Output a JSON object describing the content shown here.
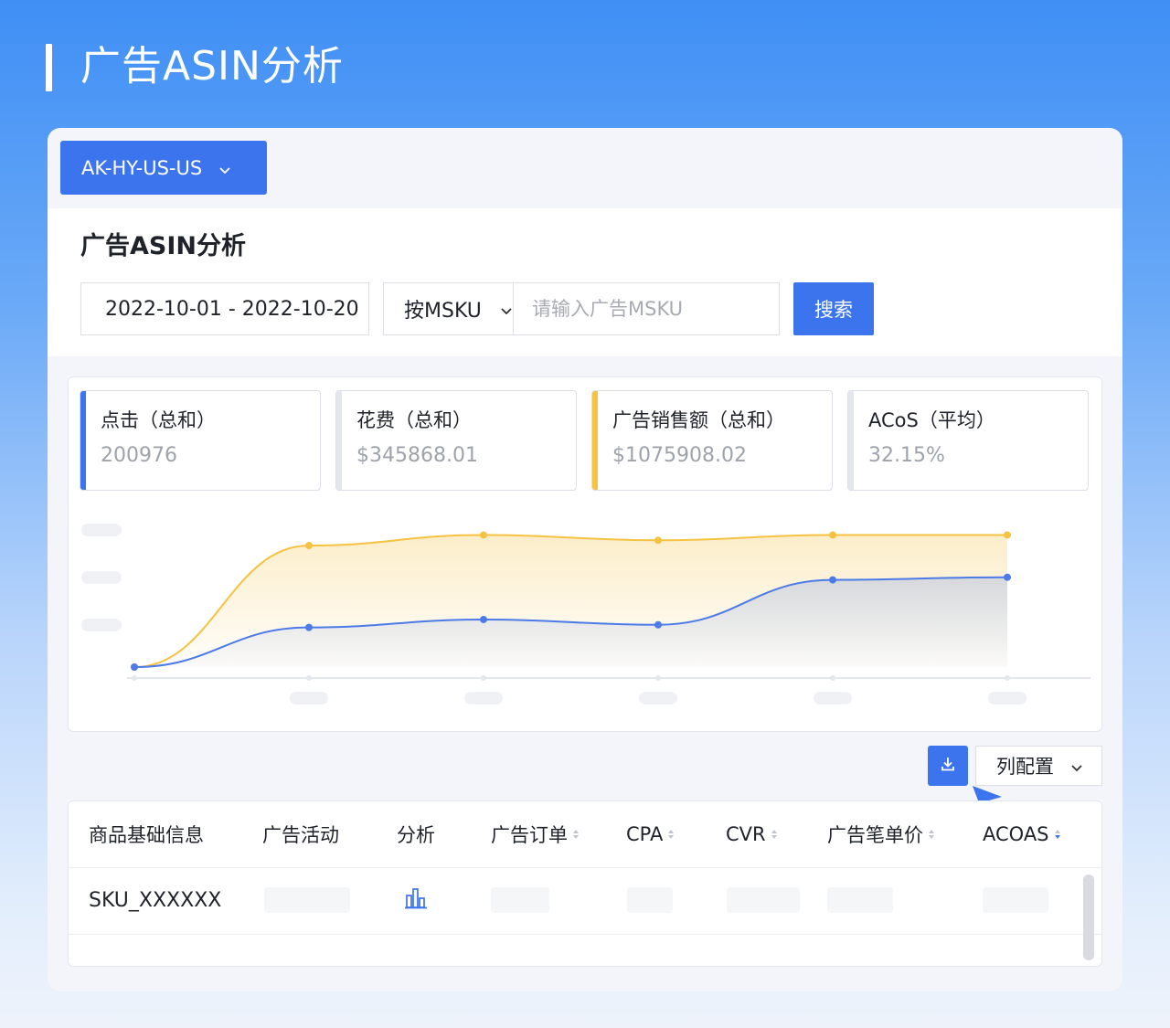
{
  "page": {
    "title": "广告ASIN分析"
  },
  "shop_selector": {
    "label": "AK-HY-US-US"
  },
  "filters": {
    "section_title": "广告ASIN分析",
    "date_range": "2022-10-01 - 2022-10-20",
    "group_by": "按MSKU",
    "search_placeholder": "请输入广告MSKU",
    "search_button": "搜索"
  },
  "metrics": [
    {
      "label": "点击（总和）",
      "value": "200976",
      "accent": "#3b74ec"
    },
    {
      "label": "花费（总和）",
      "value": "$345868.01",
      "accent": "#e4e7ed"
    },
    {
      "label": "广告销售额（总和）",
      "value": "$1075908.02",
      "accent": "#f5c242"
    },
    {
      "label": "ACoS（平均）",
      "value": "32.15%",
      "accent": "#e4e7ed"
    }
  ],
  "chart_data": {
    "type": "area",
    "series": [
      {
        "values": [
          0,
          92,
          100,
          96,
          100,
          100
        ],
        "color": "#f5c242"
      },
      {
        "values": [
          0,
          30,
          36,
          32,
          66,
          68
        ],
        "color": "#4c7be8"
      }
    ],
    "ylim": [
      0,
      110
    ]
  },
  "toolbar": {
    "download_icon": "download-icon",
    "column_config": "列配置"
  },
  "table": {
    "columns": [
      "商品基础信息",
      "广告活动",
      "分析",
      "广告订单",
      "CPA",
      "CVR",
      "广告笔单价",
      "ACOAS"
    ],
    "rows": [
      {
        "sku": "SKU_XXXXXX",
        "analysis_icon": "bar-chart-icon"
      }
    ]
  },
  "colors": {
    "primary": "#3b74ec",
    "accent_yellow": "#f5c242"
  }
}
